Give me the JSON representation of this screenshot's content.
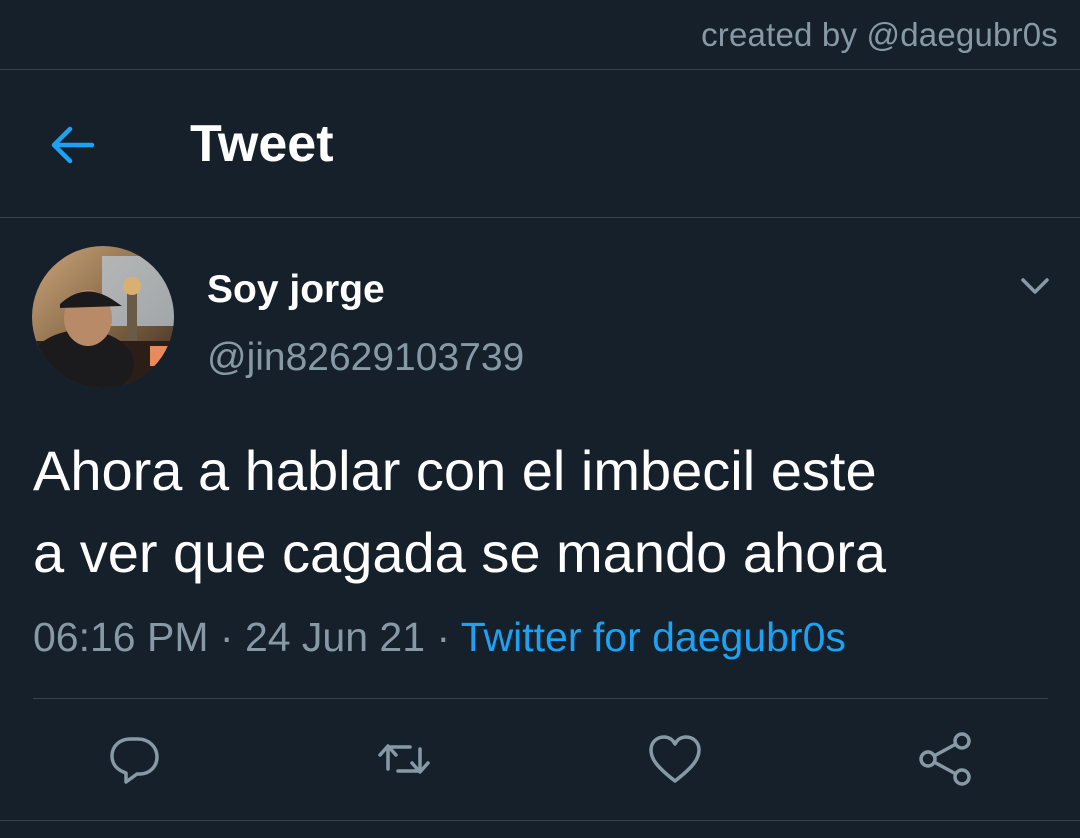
{
  "credit": {
    "text": "created by @daegubr0s"
  },
  "header": {
    "title": "Tweet",
    "back_icon": "arrow-left-icon"
  },
  "tweet": {
    "display_name": "Soy jorge",
    "handle": "@jin82629103739",
    "text_line1": "Ahora a hablar con el imbecil este",
    "text_line2": "a ver que cagada se mando ahora",
    "time": "06:16 PM",
    "separator": " · ",
    "date": "24 Jun 21",
    "source": "Twitter for daegubr0s"
  },
  "actions": [
    "reply-icon",
    "retweet-icon",
    "like-icon",
    "share-icon"
  ],
  "colors": {
    "background": "#15202b",
    "secondary_text": "#8899a6",
    "accent": "#1da1f2",
    "divider": "#38444d"
  }
}
